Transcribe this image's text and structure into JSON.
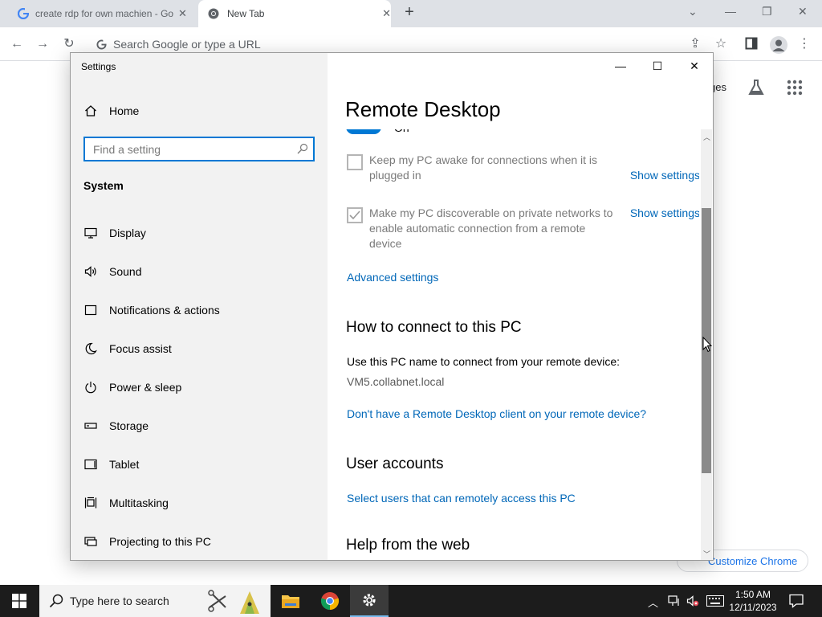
{
  "browser": {
    "tabs": [
      {
        "title": "create rdp for own machien - Go",
        "favicon": "google-g-icon"
      },
      {
        "title": "New Tab",
        "favicon": "chrome-icon"
      }
    ],
    "omnibox_placeholder": "Search Google or type a URL",
    "ntp": {
      "images_link_partial": "ges",
      "customize_label": "Customize Chrome"
    }
  },
  "settings": {
    "window_title": "Settings",
    "sidebar": {
      "home": "Home",
      "search_placeholder": "Find a setting",
      "section": "System",
      "items": [
        {
          "label": "Display",
          "icon": "monitor-icon"
        },
        {
          "label": "Sound",
          "icon": "speaker-icon"
        },
        {
          "label": "Notifications & actions",
          "icon": "notification-icon"
        },
        {
          "label": "Focus assist",
          "icon": "moon-icon"
        },
        {
          "label": "Power & sleep",
          "icon": "power-icon"
        },
        {
          "label": "Storage",
          "icon": "storage-icon"
        },
        {
          "label": "Tablet",
          "icon": "tablet-icon"
        },
        {
          "label": "Multitasking",
          "icon": "multitasking-icon"
        },
        {
          "label": "Projecting to this PC",
          "icon": "projecting-icon"
        }
      ]
    },
    "content": {
      "title": "Remote Desktop",
      "toggle_state_partial": "On",
      "options": [
        {
          "label": "Keep my PC awake for connections when it is plugged in",
          "checked": false,
          "link": "Show settings"
        },
        {
          "label": "Make my PC discoverable on private networks to enable automatic connection from a remote device",
          "checked": true,
          "link": "Show settings"
        }
      ],
      "advanced_link": "Advanced settings",
      "connect": {
        "heading": "How to connect to this PC",
        "instruction": "Use this PC name to connect from your remote device:",
        "pc_name": "VM5.collabnet.local",
        "client_link": "Don't have a Remote Desktop client on your remote device?"
      },
      "accounts": {
        "heading": "User accounts",
        "link": "Select users that can remotely access this PC"
      },
      "help_heading": "Help from the web"
    }
  },
  "taskbar": {
    "search_placeholder": "Type here to search",
    "time": "1:50 AM",
    "date": "12/11/2023"
  },
  "colors": {
    "accent": "#0078d4",
    "link": "#0067b8",
    "taskbar": "#1c1c1c",
    "chrome_tabstrip": "#dee1e6"
  }
}
